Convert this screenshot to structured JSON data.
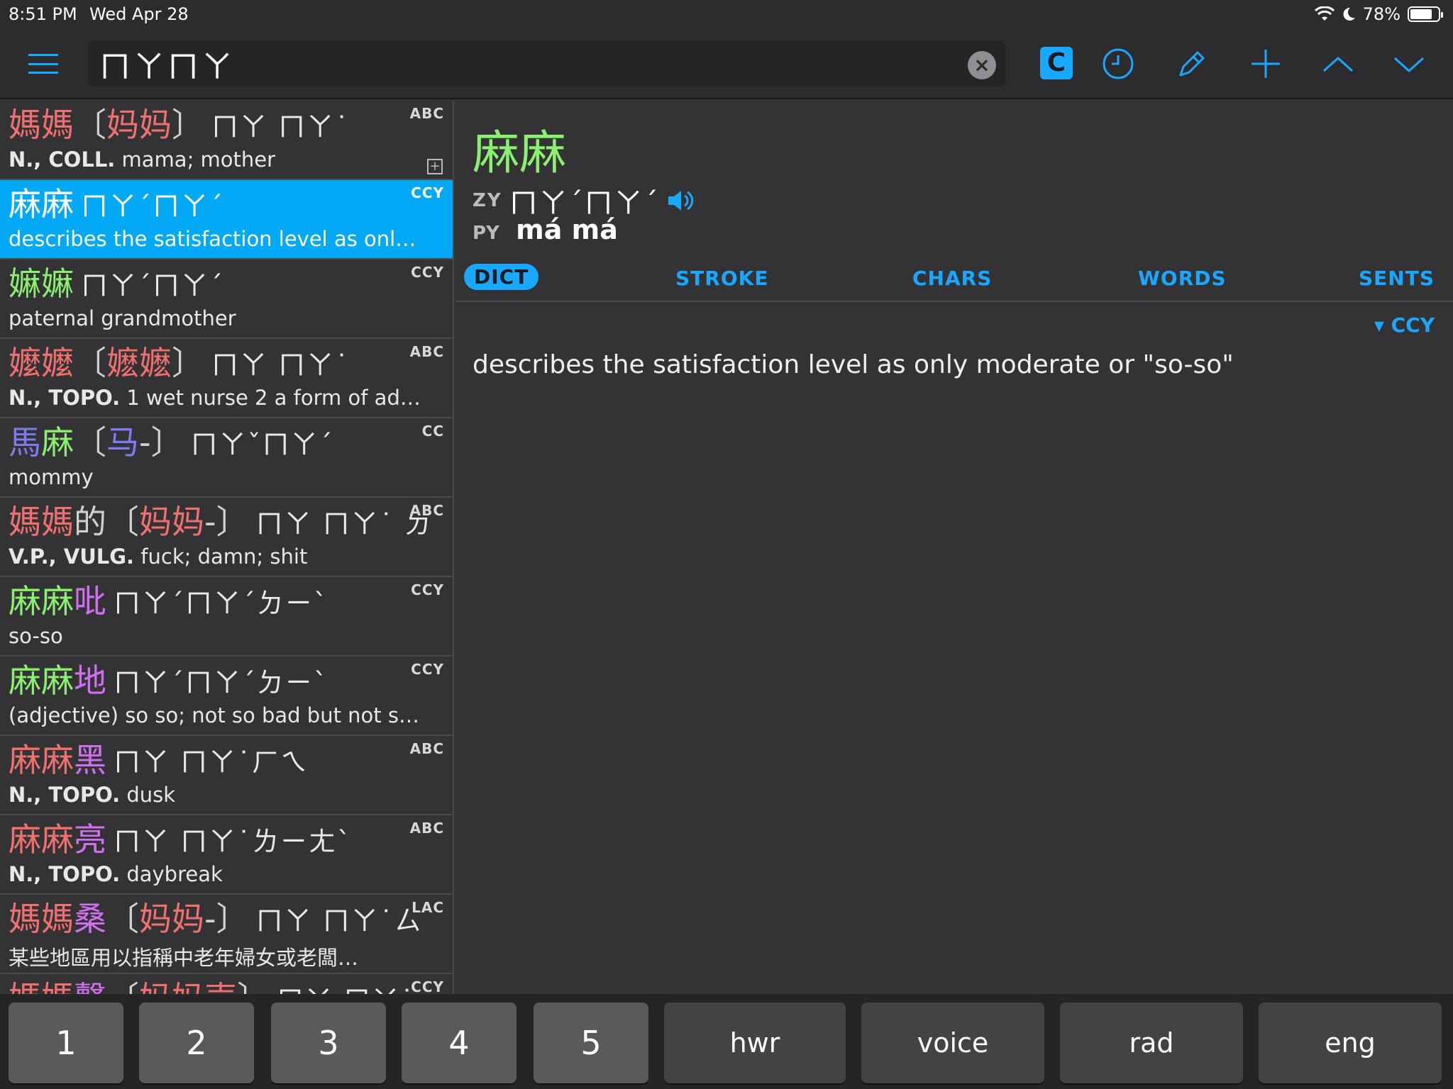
{
  "status": {
    "time": "8:51 PM",
    "date": "Wed Apr 28",
    "battery": "78%",
    "battery_level": 0.78
  },
  "toolbar": {
    "search_value": "ㄇㄚㄇㄚ",
    "c_label": "C"
  },
  "list": [
    {
      "trad": [
        {
          "t": "媽媽",
          "c": "red"
        }
      ],
      "simp": [
        {
          "t": "〔",
          "c": "gray"
        },
        {
          "t": "妈妈",
          "c": "red"
        },
        {
          "t": "〕",
          "c": "gray"
        }
      ],
      "zy": "ㄇㄚ ㄇㄚ˙",
      "src": "ABC",
      "tags": "N., COLL.",
      "def": " mama; mother",
      "expand": true
    },
    {
      "trad": [
        {
          "t": "麻麻",
          "c": "white"
        }
      ],
      "simp": [],
      "zy": "ㄇㄚˊㄇㄚˊ",
      "src": "CCY",
      "tags": "",
      "def": "describes the satisfaction level as only m…",
      "selected": true
    },
    {
      "trad": [
        {
          "t": "嫲嫲",
          "c": "green"
        }
      ],
      "simp": [],
      "zy": "ㄇㄚˊㄇㄚˊ",
      "src": "CCY",
      "tags": "",
      "def": "paternal grandmother"
    },
    {
      "trad": [
        {
          "t": "嬤嬤",
          "c": "red"
        }
      ],
      "simp": [
        {
          "t": "〔",
          "c": "gray"
        },
        {
          "t": "嬷嬷",
          "c": "red"
        },
        {
          "t": "〕",
          "c": "gray"
        }
      ],
      "zy": "ㄇㄚ ㄇㄚ˙",
      "src": "ABC",
      "tags": "N., TOPO.",
      "def": "  1 wet nurse  2 a form of addre…"
    },
    {
      "trad": [
        {
          "t": "馬",
          "c": "blue"
        },
        {
          "t": "麻",
          "c": "green"
        }
      ],
      "simp": [
        {
          "t": "〔",
          "c": "gray"
        },
        {
          "t": "马",
          "c": "blue"
        },
        {
          "t": "-〕",
          "c": "gray"
        }
      ],
      "zy": "ㄇㄚˇㄇㄚˊ",
      "src": "CC",
      "tags": "",
      "def": "mommy"
    },
    {
      "trad": [
        {
          "t": "媽媽",
          "c": "red"
        },
        {
          "t": "的",
          "c": "gray"
        }
      ],
      "simp": [
        {
          "t": "〔",
          "c": "gray"
        },
        {
          "t": "妈妈",
          "c": "red"
        },
        {
          "t": "-〕",
          "c": "gray"
        }
      ],
      "zy": "ㄇㄚ ㄇㄚ˙ ㄉ",
      "src": "ABC",
      "tags": "V.P., VULG.",
      "def": " fuck; damn; shit"
    },
    {
      "trad": [
        {
          "t": "麻麻",
          "c": "green"
        },
        {
          "t": "吡",
          "c": "purple"
        }
      ],
      "simp": [],
      "zy": "ㄇㄚˊㄇㄚˊㄉㄧˋ",
      "src": "CCY",
      "tags": "",
      "def": "so-so"
    },
    {
      "trad": [
        {
          "t": "麻麻",
          "c": "green"
        },
        {
          "t": "地",
          "c": "purple"
        }
      ],
      "simp": [],
      "zy": "ㄇㄚˊㄇㄚˊㄉㄧˋ",
      "src": "CCY",
      "tags": "",
      "def": "(adjective) so so; not so bad but not so g…"
    },
    {
      "trad": [
        {
          "t": "麻麻",
          "c": "red"
        },
        {
          "t": "黑",
          "c": "purple"
        }
      ],
      "simp": [],
      "zy": "ㄇㄚ ㄇㄚ˙ㄏㄟ",
      "src": "ABC",
      "tags": "N., TOPO.",
      "def": " dusk"
    },
    {
      "trad": [
        {
          "t": "麻麻",
          "c": "red"
        },
        {
          "t": "亮",
          "c": "purple"
        }
      ],
      "simp": [],
      "zy": "ㄇㄚ ㄇㄚ˙ㄌㄧㄤˋ",
      "src": "ABC",
      "tags": "N., TOPO.",
      "def": " daybreak"
    },
    {
      "trad": [
        {
          "t": "媽媽",
          "c": "red"
        },
        {
          "t": "桑",
          "c": "purple"
        }
      ],
      "simp": [
        {
          "t": "〔",
          "c": "gray"
        },
        {
          "t": "妈妈",
          "c": "red"
        },
        {
          "t": "-〕",
          "c": "gray"
        }
      ],
      "zy": "ㄇㄚ ㄇㄚ˙ㄙ",
      "src": "LAC",
      "tags": "",
      "def": "某些地區用以指稱中老年婦女或老闆…"
    },
    {
      "trad": [
        {
          "t": "媽媽",
          "c": "red"
        },
        {
          "t": "聲",
          "c": "purple"
        }
      ],
      "simp": [
        {
          "t": "〔",
          "c": "gray"
        },
        {
          "t": "妈妈声",
          "c": "red"
        },
        {
          "t": "〕",
          "c": "gray"
        }
      ],
      "zy": "ㄇㄚ ㄇㄚ˙",
      "src": "CCY",
      "tags": "",
      "def": ""
    }
  ],
  "detail": {
    "headword": "麻麻",
    "zy_label": "ZY",
    "zy": "ㄇㄚˊㄇㄚˊ",
    "py_label": "PY",
    "py": "má má",
    "tabs": [
      "DICT",
      "STROKE",
      "CHARS",
      "WORDS",
      "SENTS"
    ],
    "active_tab": "DICT",
    "source": "▾ CCY",
    "definition": "describes the satisfaction level as only moderate or \"so-so\""
  },
  "keybar": {
    "keys": [
      "1",
      "2",
      "3",
      "4",
      "5"
    ],
    "modes": [
      "hwr",
      "voice",
      "rad",
      "eng"
    ]
  },
  "colors": {
    "accent": "#1aa7ff",
    "selected_row": "#03a9f4",
    "tone_red": "#f07070",
    "tone_green": "#8bf070",
    "tone_blue": "#7c7cf0",
    "tone_purple": "#d070f0"
  }
}
